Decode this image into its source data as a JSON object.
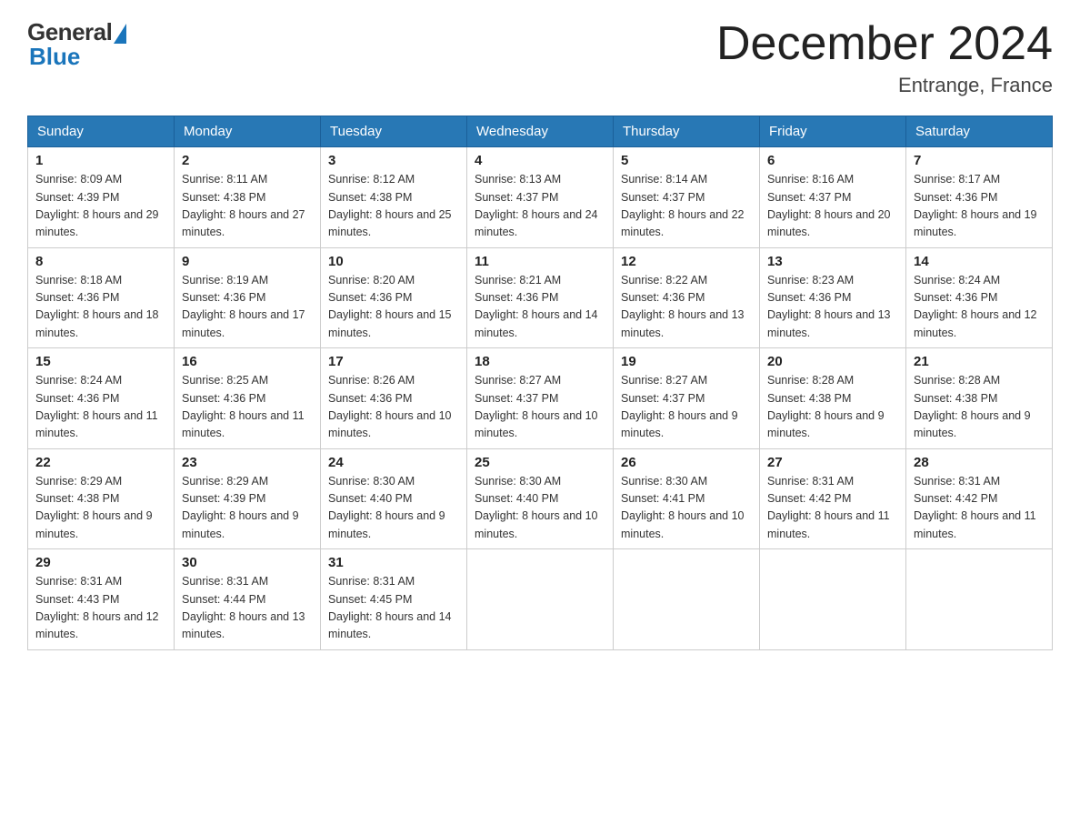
{
  "header": {
    "logo_general": "General",
    "logo_blue": "Blue",
    "title": "December 2024",
    "location": "Entrange, France"
  },
  "calendar": {
    "days_of_week": [
      "Sunday",
      "Monday",
      "Tuesday",
      "Wednesday",
      "Thursday",
      "Friday",
      "Saturday"
    ],
    "weeks": [
      [
        {
          "day": "1",
          "sunrise": "8:09 AM",
          "sunset": "4:39 PM",
          "daylight": "8 hours and 29 minutes."
        },
        {
          "day": "2",
          "sunrise": "8:11 AM",
          "sunset": "4:38 PM",
          "daylight": "8 hours and 27 minutes."
        },
        {
          "day": "3",
          "sunrise": "8:12 AM",
          "sunset": "4:38 PM",
          "daylight": "8 hours and 25 minutes."
        },
        {
          "day": "4",
          "sunrise": "8:13 AM",
          "sunset": "4:37 PM",
          "daylight": "8 hours and 24 minutes."
        },
        {
          "day": "5",
          "sunrise": "8:14 AM",
          "sunset": "4:37 PM",
          "daylight": "8 hours and 22 minutes."
        },
        {
          "day": "6",
          "sunrise": "8:16 AM",
          "sunset": "4:37 PM",
          "daylight": "8 hours and 20 minutes."
        },
        {
          "day": "7",
          "sunrise": "8:17 AM",
          "sunset": "4:36 PM",
          "daylight": "8 hours and 19 minutes."
        }
      ],
      [
        {
          "day": "8",
          "sunrise": "8:18 AM",
          "sunset": "4:36 PM",
          "daylight": "8 hours and 18 minutes."
        },
        {
          "day": "9",
          "sunrise": "8:19 AM",
          "sunset": "4:36 PM",
          "daylight": "8 hours and 17 minutes."
        },
        {
          "day": "10",
          "sunrise": "8:20 AM",
          "sunset": "4:36 PM",
          "daylight": "8 hours and 15 minutes."
        },
        {
          "day": "11",
          "sunrise": "8:21 AM",
          "sunset": "4:36 PM",
          "daylight": "8 hours and 14 minutes."
        },
        {
          "day": "12",
          "sunrise": "8:22 AM",
          "sunset": "4:36 PM",
          "daylight": "8 hours and 13 minutes."
        },
        {
          "day": "13",
          "sunrise": "8:23 AM",
          "sunset": "4:36 PM",
          "daylight": "8 hours and 13 minutes."
        },
        {
          "day": "14",
          "sunrise": "8:24 AM",
          "sunset": "4:36 PM",
          "daylight": "8 hours and 12 minutes."
        }
      ],
      [
        {
          "day": "15",
          "sunrise": "8:24 AM",
          "sunset": "4:36 PM",
          "daylight": "8 hours and 11 minutes."
        },
        {
          "day": "16",
          "sunrise": "8:25 AM",
          "sunset": "4:36 PM",
          "daylight": "8 hours and 11 minutes."
        },
        {
          "day": "17",
          "sunrise": "8:26 AM",
          "sunset": "4:36 PM",
          "daylight": "8 hours and 10 minutes."
        },
        {
          "day": "18",
          "sunrise": "8:27 AM",
          "sunset": "4:37 PM",
          "daylight": "8 hours and 10 minutes."
        },
        {
          "day": "19",
          "sunrise": "8:27 AM",
          "sunset": "4:37 PM",
          "daylight": "8 hours and 9 minutes."
        },
        {
          "day": "20",
          "sunrise": "8:28 AM",
          "sunset": "4:38 PM",
          "daylight": "8 hours and 9 minutes."
        },
        {
          "day": "21",
          "sunrise": "8:28 AM",
          "sunset": "4:38 PM",
          "daylight": "8 hours and 9 minutes."
        }
      ],
      [
        {
          "day": "22",
          "sunrise": "8:29 AM",
          "sunset": "4:38 PM",
          "daylight": "8 hours and 9 minutes."
        },
        {
          "day": "23",
          "sunrise": "8:29 AM",
          "sunset": "4:39 PM",
          "daylight": "8 hours and 9 minutes."
        },
        {
          "day": "24",
          "sunrise": "8:30 AM",
          "sunset": "4:40 PM",
          "daylight": "8 hours and 9 minutes."
        },
        {
          "day": "25",
          "sunrise": "8:30 AM",
          "sunset": "4:40 PM",
          "daylight": "8 hours and 10 minutes."
        },
        {
          "day": "26",
          "sunrise": "8:30 AM",
          "sunset": "4:41 PM",
          "daylight": "8 hours and 10 minutes."
        },
        {
          "day": "27",
          "sunrise": "8:31 AM",
          "sunset": "4:42 PM",
          "daylight": "8 hours and 11 minutes."
        },
        {
          "day": "28",
          "sunrise": "8:31 AM",
          "sunset": "4:42 PM",
          "daylight": "8 hours and 11 minutes."
        }
      ],
      [
        {
          "day": "29",
          "sunrise": "8:31 AM",
          "sunset": "4:43 PM",
          "daylight": "8 hours and 12 minutes."
        },
        {
          "day": "30",
          "sunrise": "8:31 AM",
          "sunset": "4:44 PM",
          "daylight": "8 hours and 13 minutes."
        },
        {
          "day": "31",
          "sunrise": "8:31 AM",
          "sunset": "4:45 PM",
          "daylight": "8 hours and 14 minutes."
        },
        null,
        null,
        null,
        null
      ]
    ]
  }
}
